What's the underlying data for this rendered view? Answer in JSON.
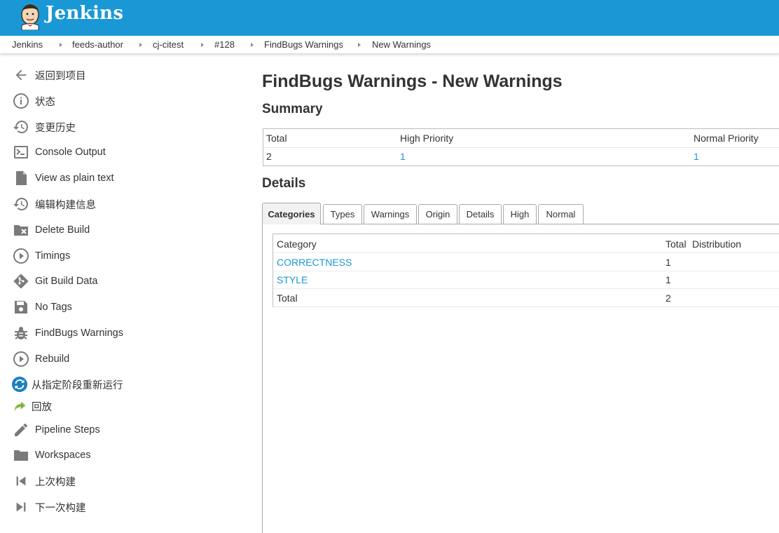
{
  "header": {
    "brand": "Jenkins"
  },
  "breadcrumb": [
    "Jenkins",
    "feeds-author",
    "cj-citest",
    "#128",
    "FindBugs Warnings",
    "New Warnings"
  ],
  "sidebar": {
    "items": [
      {
        "label": "返回到项目",
        "icon": "arrow-left-icon"
      },
      {
        "label": "状态",
        "icon": "info-icon"
      },
      {
        "label": "变更历史",
        "icon": "history-icon"
      },
      {
        "label": "Console Output",
        "icon": "terminal-icon"
      },
      {
        "label": "View as plain text",
        "icon": "document-icon"
      },
      {
        "label": "编辑构建信息",
        "icon": "history-icon"
      },
      {
        "label": "Delete Build",
        "icon": "folder-delete-icon"
      },
      {
        "label": "Timings",
        "icon": "play-circle-icon"
      },
      {
        "label": "Git Build Data",
        "icon": "git-icon"
      },
      {
        "label": "No Tags",
        "icon": "save-icon"
      },
      {
        "label": "FindBugs Warnings",
        "icon": "bug-icon"
      },
      {
        "label": "Rebuild",
        "icon": "play-circle-icon"
      },
      {
        "label": "从指定阶段重新运行",
        "icon": "refresh-icon"
      },
      {
        "label": "回放",
        "icon": "replay-arrow-icon"
      },
      {
        "label": "Pipeline Steps",
        "icon": "pencil-icon"
      },
      {
        "label": "Workspaces",
        "icon": "folder-icon"
      },
      {
        "label": "上次构建",
        "icon": "skip-previous-icon"
      },
      {
        "label": "下一次构建",
        "icon": "skip-next-icon"
      }
    ]
  },
  "main": {
    "title": "FindBugs Warnings - New Warnings",
    "summary_heading": "Summary",
    "summary": {
      "headers": [
        "Total",
        "High Priority",
        "Normal Priority"
      ],
      "values": [
        "2",
        "1",
        "1"
      ]
    },
    "details_heading": "Details",
    "tabs": [
      "Categories",
      "Types",
      "Warnings",
      "Origin",
      "Details",
      "High",
      "Normal"
    ],
    "active_tab": "Categories",
    "categories_table": {
      "headers": [
        "Category",
        "Total",
        "Distribution"
      ],
      "rows": [
        {
          "category": "CORRECTNESS",
          "total": "1"
        },
        {
          "category": "STYLE",
          "total": "1"
        }
      ],
      "footer": {
        "label": "Total",
        "total": "2"
      }
    }
  },
  "colors": {
    "header_bg": "#1a98d5",
    "link": "#1a98d5",
    "text": "#333333",
    "icon": "#7a7a7a"
  }
}
